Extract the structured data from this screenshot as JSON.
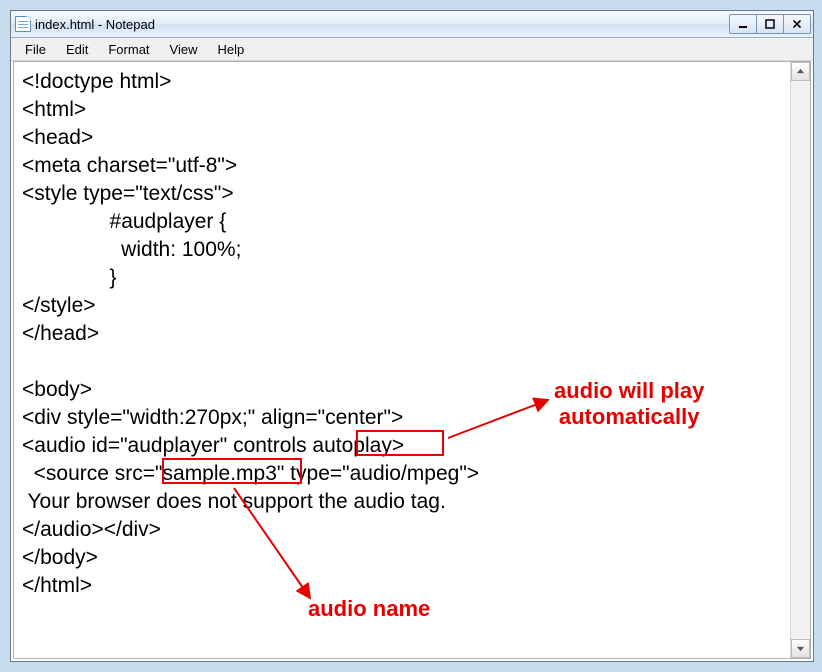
{
  "window": {
    "title": "index.html - Notepad"
  },
  "menubar": {
    "items": [
      {
        "label": "File"
      },
      {
        "label": "Edit"
      },
      {
        "label": "Format"
      },
      {
        "label": "View"
      },
      {
        "label": "Help"
      }
    ]
  },
  "editor": {
    "content": "<!doctype html>\n<html>\n<head>\n<meta charset=\"utf-8\">\n<style type=\"text/css\">\n               #audplayer {\n                 width: 100%;\n               }\n</style>\n</head>\n\n<body>\n<div style=\"width:270px;\" align=\"center\">\n<audio id=\"audplayer\" controls autoplay>\n  <source src=\"sample.mp3\" type=\"audio/mpeg\">\n Your browser does not support the audio tag.\n</audio></div>\n</body>\n</html>"
  },
  "annotations": {
    "a1": {
      "text": "audio will play\nautomatically"
    },
    "a2": {
      "text": "audio name"
    }
  }
}
